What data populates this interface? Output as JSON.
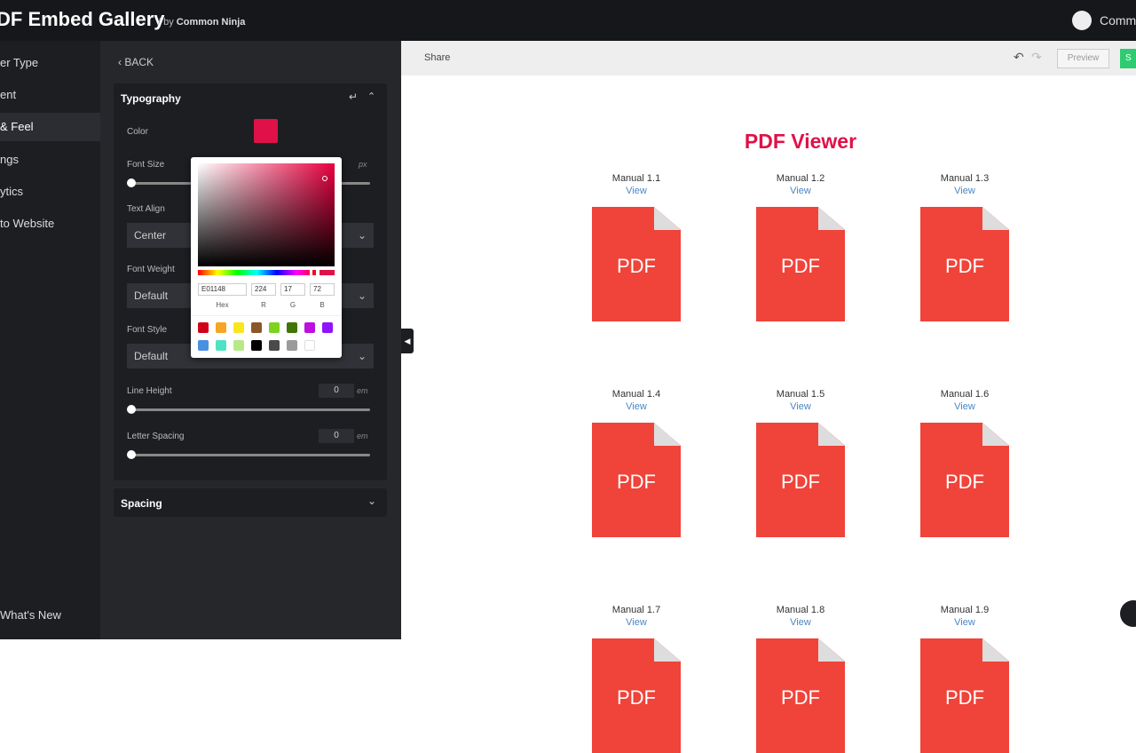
{
  "header": {
    "title": "DF Embed Gallery",
    "by": "/  by",
    "brand": "Common Ninja",
    "account": "Commo"
  },
  "sidebar": {
    "items": [
      {
        "label": "er Type"
      },
      {
        "label": "ent"
      },
      {
        "label": "& Feel",
        "active": true
      },
      {
        "label": "ngs"
      },
      {
        "label": "ytics"
      },
      {
        "label": "to Website"
      }
    ],
    "whats_new": "What's New"
  },
  "panel": {
    "back": "BACK",
    "typography": {
      "title": "Typography",
      "color_label": "Color",
      "color_value": "#E01148",
      "font_size_label": "Font Size",
      "font_size_unit": "px",
      "text_align_label": "Text Align",
      "text_align": "Center",
      "font_weight_label": "Font Weight",
      "font_weight": "Default",
      "font_style_label": "Font Style",
      "font_style": "Default",
      "line_height_label": "Line Height",
      "line_height": "0",
      "line_height_unit": "em",
      "letter_spacing_label": "Letter Spacing",
      "letter_spacing": "0",
      "letter_spacing_unit": "em"
    },
    "spacing": {
      "title": "Spacing"
    }
  },
  "picker": {
    "hex": "E01148",
    "r": "224",
    "g": "17",
    "b": "72",
    "hex_label": "Hex",
    "r_label": "R",
    "g_label": "G",
    "b_label": "B",
    "swatches": [
      "#d0021b",
      "#f5a623",
      "#f8e71c",
      "#8b572a",
      "#7ed321",
      "#417505",
      "#bd10e0",
      "#9013fe",
      "#4a90e2",
      "#50e3c2",
      "#b8e986",
      "#000000",
      "#4a4a4a",
      "#9b9b9b",
      "#ffffff"
    ]
  },
  "preview": {
    "share": "Share",
    "preview_button": "Preview",
    "save_button": "S",
    "title": "PDF Viewer",
    "icon_text": "PDF",
    "view_label": "View",
    "items": [
      "Manual 1.1",
      "Manual 1.2",
      "Manual 1.3",
      "Manual 1.4",
      "Manual 1.5",
      "Manual 1.6",
      "Manual 1.7",
      "Manual 1.8",
      "Manual 1.9"
    ]
  }
}
